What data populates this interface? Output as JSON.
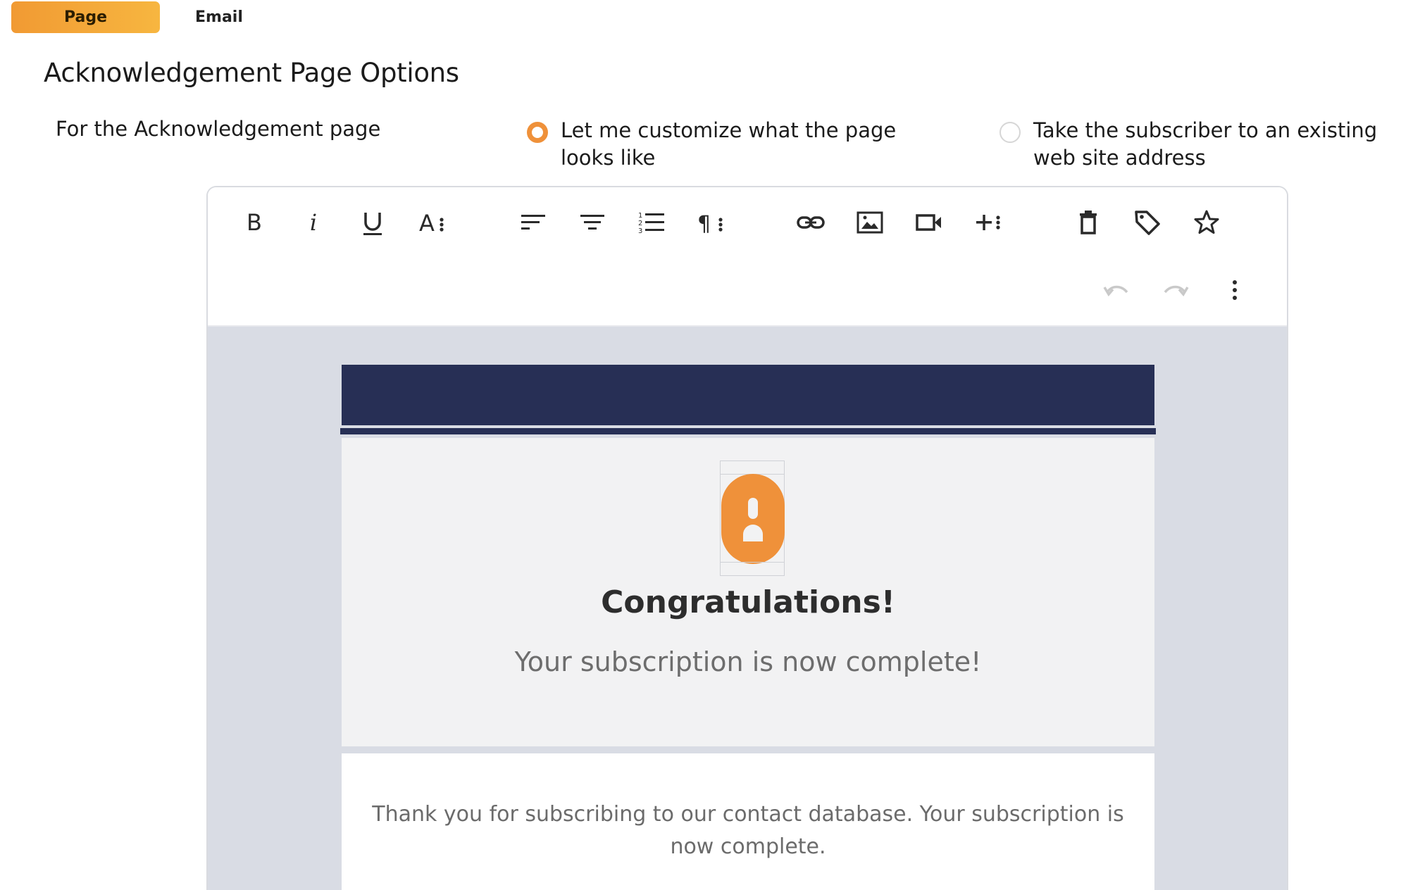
{
  "tabs": [
    {
      "label": "Page",
      "active": true
    },
    {
      "label": "Email",
      "active": false
    }
  ],
  "page_title": "Acknowledgement Page Options",
  "option_label": "For the Acknowledgement page",
  "radio_options": [
    {
      "label": "Let me customize what the page looks like",
      "selected": true
    },
    {
      "label": "Take the subscriber to an existing web site address",
      "selected": false
    }
  ],
  "toolbar": {
    "icons": [
      "bold-icon",
      "italic-icon",
      "underline-icon",
      "font-size-icon",
      "align-left-icon",
      "align-center-icon",
      "ordered-list-icon",
      "paragraph-format-icon",
      "link-icon",
      "image-icon",
      "video-icon",
      "insert-more-icon",
      "trash-icon",
      "tag-icon",
      "star-icon",
      "undo-icon",
      "redo-icon",
      "more-vertical-icon"
    ]
  },
  "content": {
    "congrats_title": "Congratulations!",
    "congrats_subtitle": "Your subscription is now complete!",
    "body_text": "Thank you for subscribing to our contact database. Your subscription is now complete."
  },
  "colors": {
    "accent": "#ef913a",
    "header_band": "#272f55",
    "canvas_bg": "#d9dce4"
  }
}
